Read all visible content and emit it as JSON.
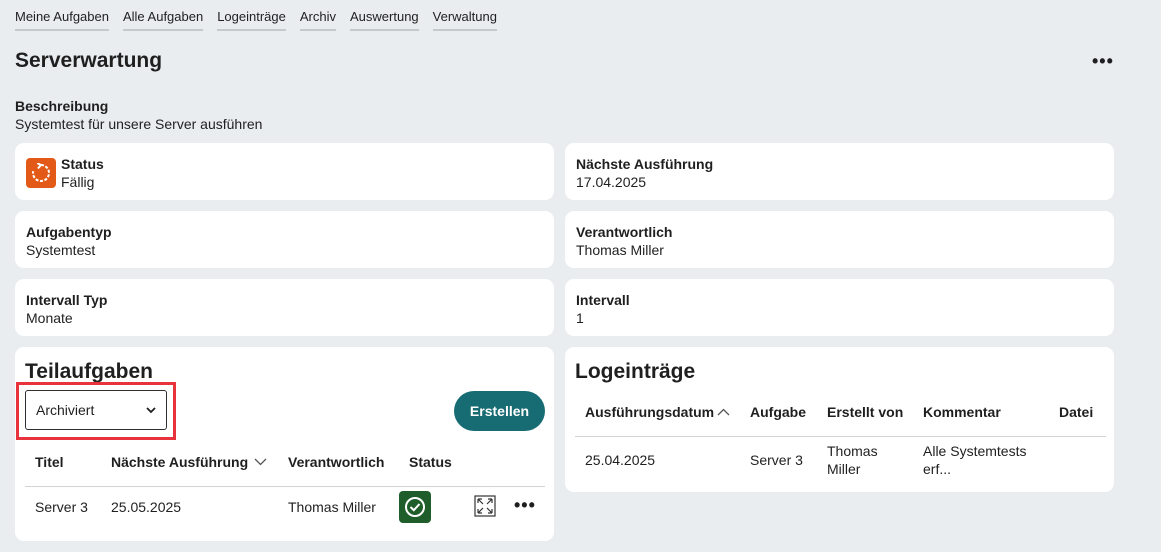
{
  "nav": {
    "items": [
      "Meine Aufgaben",
      "Alle Aufgaben",
      "Logeinträge",
      "Archiv",
      "Auswertung",
      "Verwaltung"
    ]
  },
  "page": {
    "title": "Serverwartung",
    "more": "•••",
    "description_label": "Beschreibung",
    "description_value": "Systemtest für unsere Server ausführen"
  },
  "info": {
    "status_label": "Status",
    "status_value": "Fällig",
    "next_label": "Nächste Ausführung",
    "next_value": "17.04.2025",
    "type_label": "Aufgabentyp",
    "type_value": "Systemtest",
    "resp_label": "Verantwortlich",
    "resp_value": "Thomas Miller",
    "interval_type_label": "Intervall Typ",
    "interval_type_value": "Monate",
    "interval_label": "Intervall",
    "interval_value": "1"
  },
  "subtasks": {
    "title": "Teilaufgaben",
    "filter_value": "Archiviert",
    "create_label": "Erstellen",
    "columns": [
      "Titel",
      "Nächste Ausführung",
      "Verantwortlich",
      "Status"
    ],
    "rows": [
      {
        "title": "Server 3",
        "next": "25.05.2025",
        "responsible": "Thomas Miller"
      }
    ],
    "row_more": "•••"
  },
  "logs": {
    "title": "Logeinträge",
    "columns": [
      "Ausführungsdatum",
      "Aufgabe",
      "Erstellt von",
      "Kommentar",
      "Datei"
    ],
    "rows": [
      {
        "date": "25.04.2025",
        "task": "Server 3",
        "creator_line1": "Thomas",
        "creator_line2": "Miller",
        "comment_line1": "Alle Systemtests",
        "comment_line2": "erf..."
      }
    ]
  },
  "colors": {
    "accent": "#176b73",
    "status_due": "#e35a18",
    "status_ok": "#1f5e2a",
    "highlight": "#e8323c"
  }
}
